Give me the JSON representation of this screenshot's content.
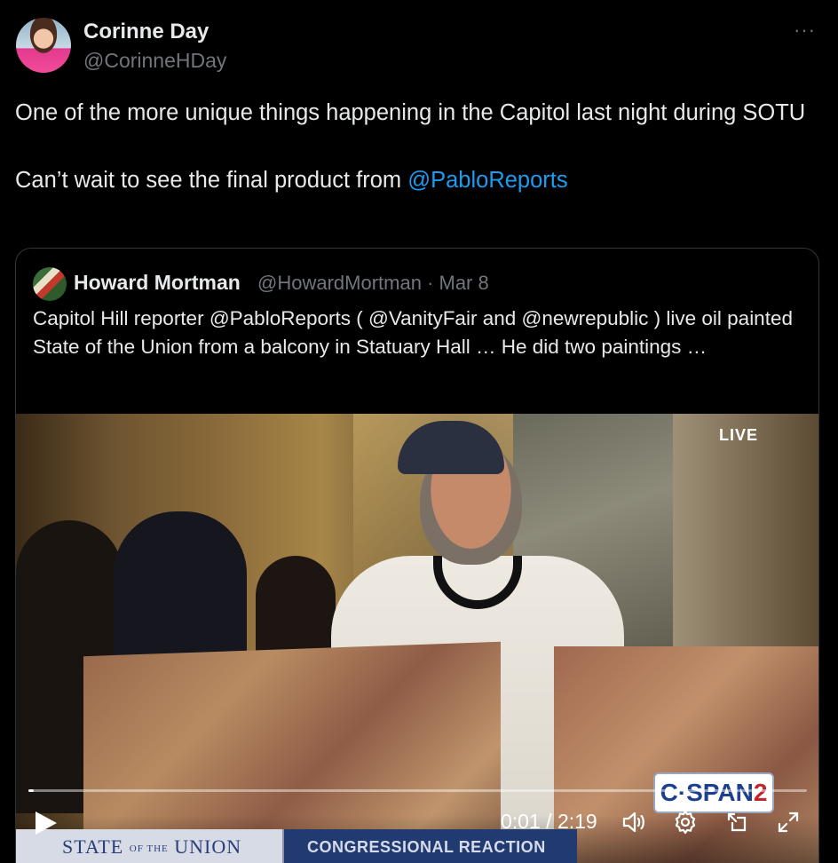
{
  "tweet": {
    "author_name": "Corinne Day",
    "author_handle": "@CorinneHDay",
    "more_glyph": "···",
    "text_line1": "One of the more unique things happening in the Capitol last night during SOTU",
    "text_line2_prefix": "Can’t wait to see the final product from ",
    "text_line2_mention": "@PabloReports"
  },
  "quote": {
    "author_name": "Howard Mortman",
    "author_handle": "@HowardMortman",
    "separator": " · ",
    "date": "Mar 8",
    "text": "Capitol Hill reporter @PabloReports ( @VanityFair and @newrepublic ) live oil painted State of the Union from a balcony in Statuary Hall … He did two paintings …"
  },
  "video": {
    "live_label": "LIVE",
    "cspan_main": "C·SPAN",
    "cspan_num": "2",
    "banner_state": "STATE",
    "banner_of_the": "OF THE",
    "banner_union": "UNION",
    "banner_congress": "CONGRESSIONAL REACTION",
    "time_current": "0:01",
    "time_sep": " / ",
    "time_total": "2:19",
    "progress_fraction": 0.007
  },
  "colors": {
    "background": "#000000",
    "text": "#e7e9ea",
    "muted": "#71767b",
    "link": "#1d9bf0",
    "border": "#333639"
  },
  "icons": [
    "more-icon",
    "play-icon",
    "volume-icon",
    "settings-icon",
    "pip-icon",
    "fullscreen-icon"
  ]
}
